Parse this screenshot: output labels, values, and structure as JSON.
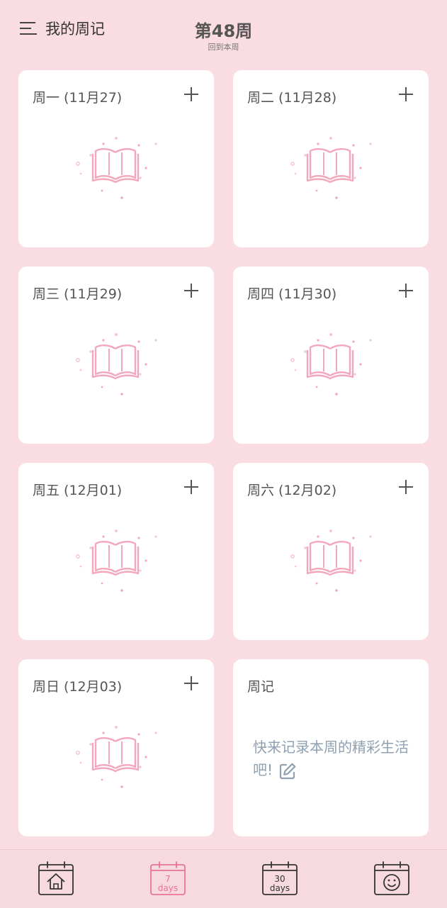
{
  "header": {
    "menu_label": "我的周记",
    "week_title": "第48周",
    "back_to_week": "回到本周"
  },
  "days": [
    {
      "label": "周一 (11月27)"
    },
    {
      "label": "周二 (11月28)"
    },
    {
      "label": "周三 (11月29)"
    },
    {
      "label": "周四 (11月30)"
    },
    {
      "label": "周五 (12月01)"
    },
    {
      "label": "周六 (12月02)"
    },
    {
      "label": "周日 (12月03)"
    }
  ],
  "weekly": {
    "title": "周记",
    "prompt": "快来记录本周的精彩生活吧!"
  },
  "bottom_nav": [
    {
      "icon": "home-calendar-icon",
      "active": false
    },
    {
      "icon": "seven-days-calendar-icon",
      "num": "7",
      "days": "days",
      "active": true
    },
    {
      "icon": "thirty-days-calendar-icon",
      "num": "30",
      "days": "days",
      "active": false
    },
    {
      "icon": "smiley-calendar-icon",
      "active": false
    }
  ],
  "colors": {
    "background": "#f9dde3",
    "card": "#ffffff",
    "accent_pink": "#e8739a",
    "illustration_pink": "#f2a7bd",
    "prompt_text": "#8fa0b0"
  }
}
